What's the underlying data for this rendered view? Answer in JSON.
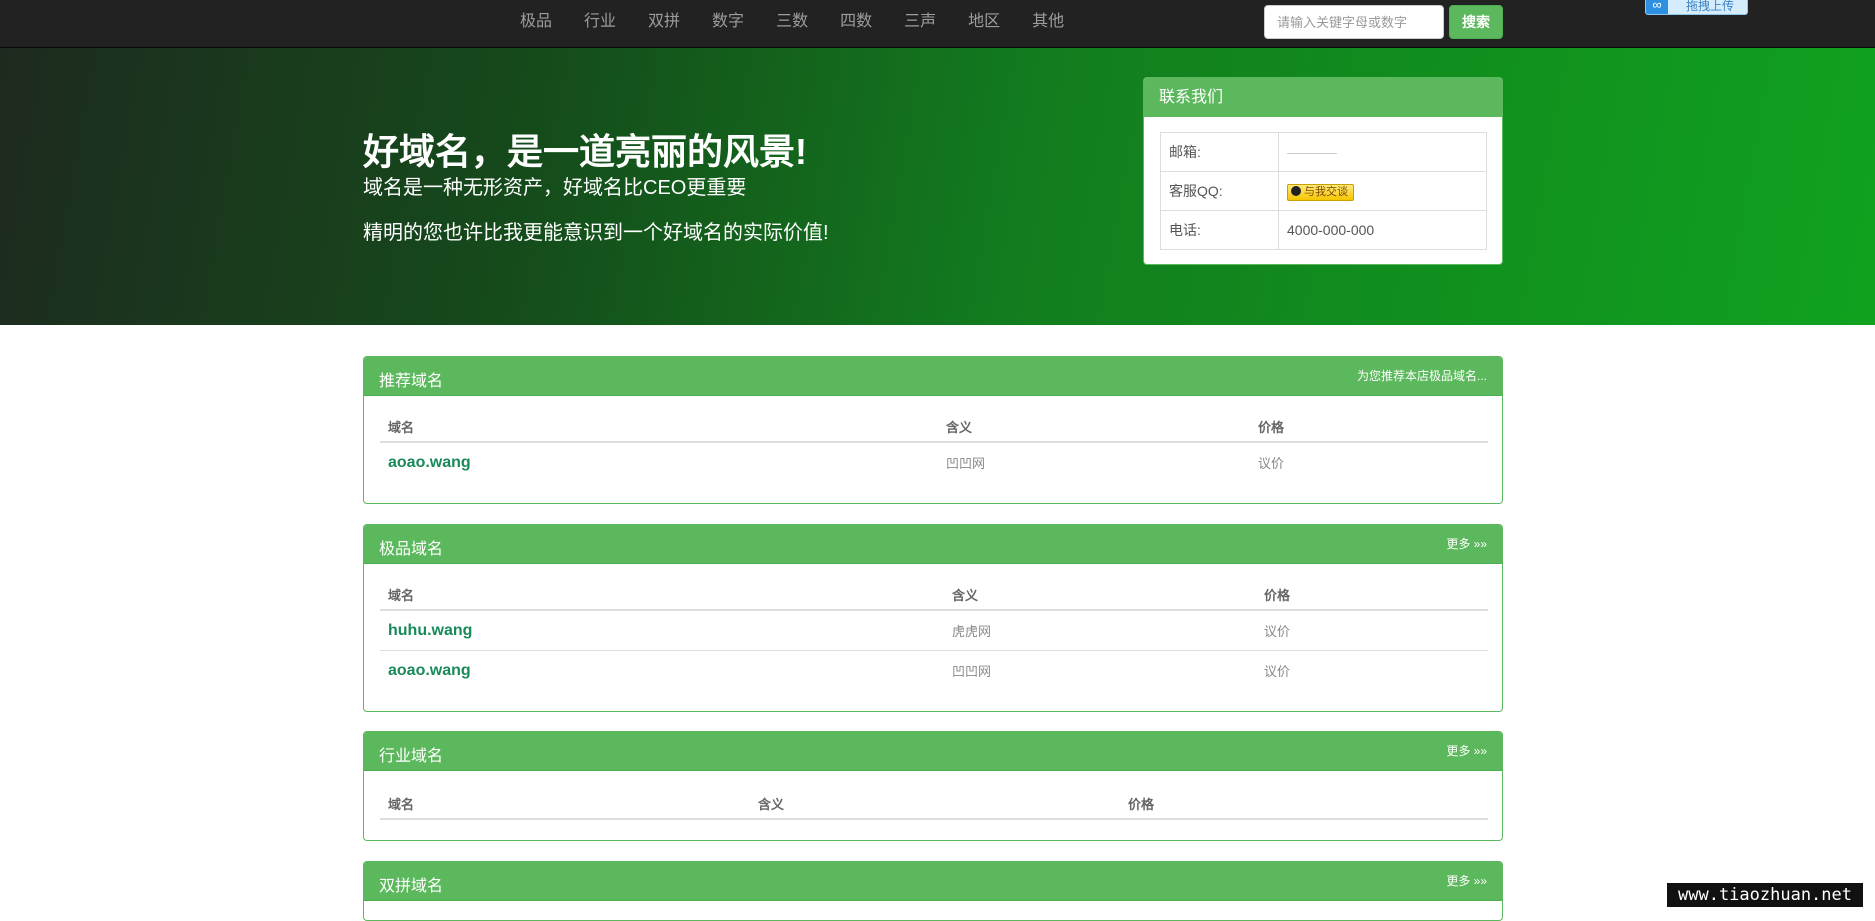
{
  "nav": {
    "links": [
      "极品",
      "行业",
      "双拼",
      "数字",
      "三数",
      "四数",
      "三声",
      "地区",
      "其他"
    ],
    "search_placeholder": "请输入关键字母或数字",
    "search_button": "搜索",
    "upload_label": "拖拽上传"
  },
  "hero": {
    "title": "好域名，是一道亮丽的风景!",
    "subtitle1": "域名是一种无形资产，好域名比CEO更重要",
    "subtitle2": "精明的您也许比我更能意识到一个好域名的实际价值!"
  },
  "contact": {
    "title": "联系我们",
    "email_label": "邮箱:",
    "qq_label": "客服QQ:",
    "qq_button": "与我交谈",
    "phone_label": "电话:",
    "phone_value": "4000-000-000"
  },
  "panels": [
    {
      "title": "推荐域名",
      "more": "为您推荐本店极品域名...",
      "headers": [
        "域名",
        "含义",
        "价格"
      ],
      "rows": [
        {
          "domain": "aoao.wang",
          "meaning": "凹凹网",
          "price": "议价"
        }
      ]
    },
    {
      "title": "极品域名",
      "more": "更多 »»",
      "headers": [
        "域名",
        "含义",
        "价格"
      ],
      "rows": [
        {
          "domain": "huhu.wang",
          "meaning": "虎虎网",
          "price": "议价"
        },
        {
          "domain": "aoao.wang",
          "meaning": "凹凹网",
          "price": "议价"
        }
      ]
    },
    {
      "title": "行业域名",
      "more": "更多 »»",
      "headers": [
        "域名",
        "含义",
        "价格"
      ],
      "rows": []
    },
    {
      "title": "双拼域名",
      "more": "更多 »»",
      "headers": [],
      "rows": []
    }
  ],
  "watermark": "www.tiaozhuan.net"
}
